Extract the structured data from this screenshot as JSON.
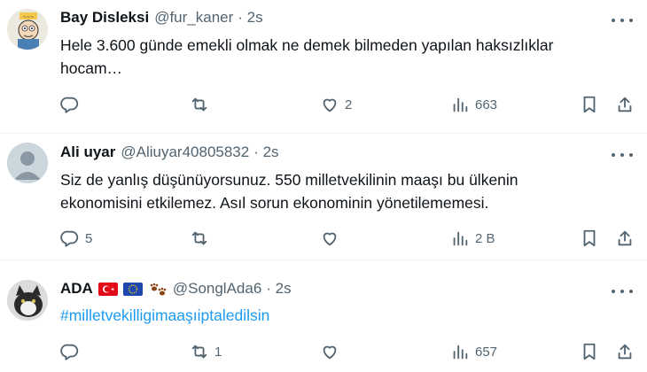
{
  "tweets": [
    {
      "name": "Bay Disleksi",
      "handle": "@fur_kaner",
      "time": "· 2s",
      "text": "Hele 3.600 günde emekli olmak ne demek bilmeden yapılan haksızlıklar hocam…",
      "reply_count": "",
      "retweet_count": "",
      "like_count": "2",
      "view_count": "663"
    },
    {
      "name": "Ali uyar",
      "handle": "@Aliuyar40805832",
      "time": "· 2s",
      "text": "Siz de yanlış düşünüyorsunuz. 550 milletvekilinin maaşı bu ülkenin ekonomisini etkilemez. Asıl sorun ekonominin yönetilememesi.",
      "reply_count": "5",
      "retweet_count": "",
      "like_count": "",
      "view_count": "2 B"
    },
    {
      "name": "ADA",
      "handle": "@SonglAda6",
      "time": "· 2s",
      "text": "#milletvekilligimaaşıiptaledilsin",
      "reply_count": "",
      "retweet_count": "1",
      "like_count": "",
      "view_count": "657"
    }
  ],
  "icons": {
    "reply": "reply-icon",
    "retweet": "retweet-icon",
    "like": "heart-icon",
    "views": "views-icon",
    "bookmark": "bookmark-icon",
    "share": "share-icon",
    "more": "more-icon"
  },
  "colors": {
    "text": "#0f1419",
    "secondary": "#536471",
    "link": "#1d9bf0",
    "divider": "#eff3f4"
  }
}
